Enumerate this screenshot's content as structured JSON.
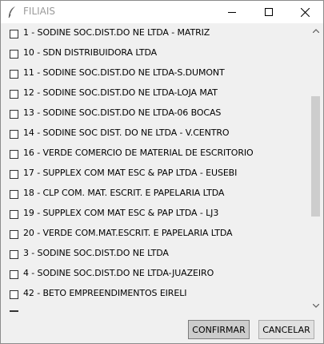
{
  "window": {
    "title": "FILIAIS"
  },
  "items": [
    "1 - SODINE SOC.DIST.DO NE LTDA - MATRIZ",
    "10 - SDN DISTRIBUIDORA LTDA",
    "11 - SODINE SOC.DIST.DO NE LTDA-S.DUMONT",
    "12 - SODINE SOC.DIST.DO NE LTDA-LOJA MAT",
    "13 - SODINE SOC.DIST.DO NE LTDA-06 BOCAS",
    "14 - SODINE SOC DIST. DO NE LTDA - V.CENTRO",
    "16 - VERDE COMERCIO DE MATERIAL DE ESCRITORIO",
    "17 - SUPPLEX COM MAT  ESC & PAP LTDA - EUSEBI",
    "18 - CLP COM. MAT. ESCRIT. E PAPELARIA LTDA",
    "19 - SUPPLEX COM MAT ESC & PAP LTDA - LJ3",
    "20 - VERDE COM.MAT.ESCRIT. E PAPELARIA LTDA",
    "3 - SODINE SOC.DIST.DO NE LTDA",
    "4 - SODINE SOC.DIST.DO NE LTDA-JUAZEIRO",
    "42 - BETO EMPREENDIMENTOS EIRELI"
  ],
  "checked": [
    false,
    false,
    false,
    false,
    false,
    false,
    false,
    false,
    false,
    false,
    false,
    false,
    false,
    false
  ],
  "buttons": {
    "confirm": "CONFIRMAR",
    "cancel": "CANCELAR"
  },
  "icons": {
    "app": "feather-icon",
    "minimize": "minimize-icon",
    "maximize": "maximize-icon",
    "close": "close-icon",
    "scroll_up": "chevron-up-icon",
    "scroll_down": "chevron-down-icon"
  }
}
